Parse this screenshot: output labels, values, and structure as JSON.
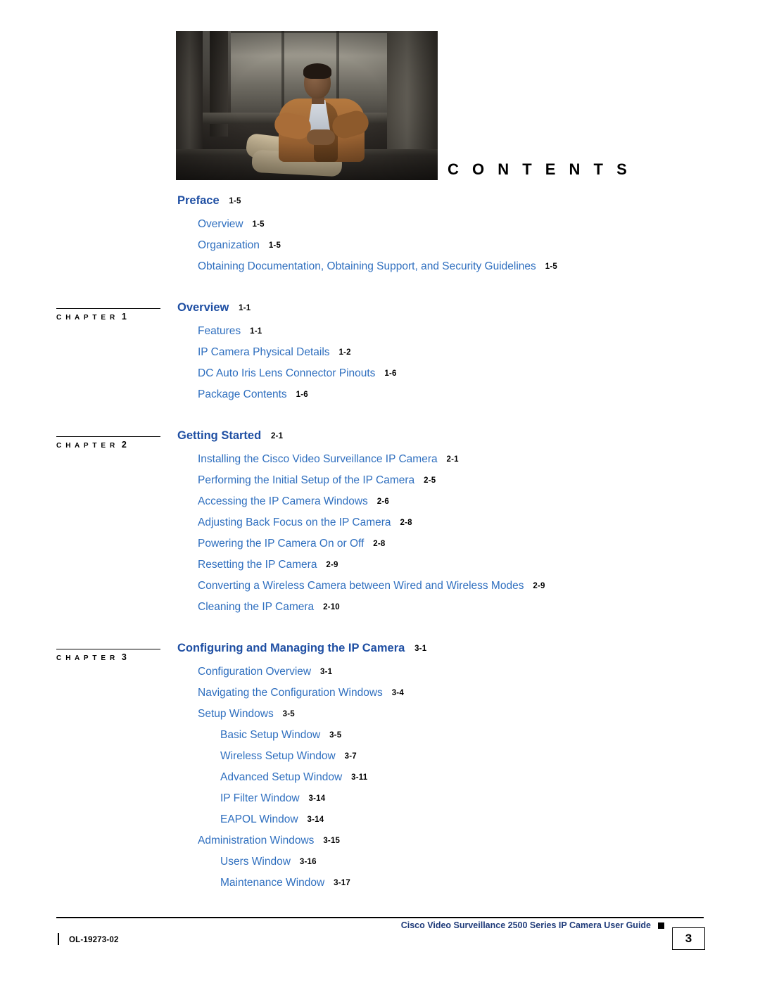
{
  "heading": "C O N T E N T S",
  "chapter_label": "C H A P T E R",
  "toc": [
    {
      "level": "h",
      "text": "Preface",
      "page": "1-5",
      "gap": "none"
    },
    {
      "level": "1",
      "text": "Overview",
      "page": "1-5",
      "gap": "afterh"
    },
    {
      "level": "1",
      "text": "Organization",
      "page": "1-5",
      "gap": "normal"
    },
    {
      "level": "1",
      "text": "Obtaining Documentation, Obtaining Support, and Security Guidelines",
      "page": "1-5",
      "gap": "normal"
    },
    {
      "level": "h",
      "text": "Overview",
      "page": "1-1",
      "gap": "big",
      "chapter": "1"
    },
    {
      "level": "1",
      "text": "Features",
      "page": "1-1",
      "gap": "afterh"
    },
    {
      "level": "1",
      "text": "IP Camera Physical Details",
      "page": "1-2",
      "gap": "normal"
    },
    {
      "level": "1",
      "text": "DC Auto Iris Lens Connector Pinouts",
      "page": "1-6",
      "gap": "normal"
    },
    {
      "level": "1",
      "text": "Package Contents",
      "page": "1-6",
      "gap": "normal"
    },
    {
      "level": "h",
      "text": "Getting Started",
      "page": "2-1",
      "gap": "big",
      "chapter": "2"
    },
    {
      "level": "1",
      "text": "Installing the Cisco Video Surveillance IP Camera",
      "page": "2-1",
      "gap": "afterh"
    },
    {
      "level": "1",
      "text": "Performing the Initial Setup of the IP Camera",
      "page": "2-5",
      "gap": "normal"
    },
    {
      "level": "1",
      "text": "Accessing the IP Camera Windows",
      "page": "2-6",
      "gap": "normal"
    },
    {
      "level": "1",
      "text": "Adjusting Back Focus on the IP Camera",
      "page": "2-8",
      "gap": "normal"
    },
    {
      "level": "1",
      "text": "Powering the IP Camera On or Off",
      "page": "2-8",
      "gap": "normal"
    },
    {
      "level": "1",
      "text": "Resetting the IP Camera",
      "page": "2-9",
      "gap": "normal"
    },
    {
      "level": "1",
      "text": "Converting a Wireless Camera between Wired and Wireless Modes",
      "page": "2-9",
      "gap": "normal"
    },
    {
      "level": "1",
      "text": "Cleaning the IP Camera",
      "page": "2-10",
      "gap": "normal"
    },
    {
      "level": "h",
      "text": "Configuring and Managing the IP Camera",
      "page": "3-1",
      "gap": "big",
      "chapter": "3"
    },
    {
      "level": "1",
      "text": "Configuration Overview",
      "page": "3-1",
      "gap": "afterh"
    },
    {
      "level": "1",
      "text": "Navigating the Configuration Windows",
      "page": "3-4",
      "gap": "normal"
    },
    {
      "level": "1",
      "text": "Setup Windows",
      "page": "3-5",
      "gap": "normal"
    },
    {
      "level": "2",
      "text": "Basic Setup Window",
      "page": "3-5",
      "gap": "normal"
    },
    {
      "level": "2",
      "text": "Wireless Setup Window",
      "page": "3-7",
      "gap": "normal"
    },
    {
      "level": "2",
      "text": "Advanced Setup Window",
      "page": "3-11",
      "gap": "normal"
    },
    {
      "level": "2",
      "text": "IP Filter Window",
      "page": "3-14",
      "gap": "normal"
    },
    {
      "level": "2",
      "text": "EAPOL Window",
      "page": "3-14",
      "gap": "normal"
    },
    {
      "level": "1",
      "text": "Administration Windows",
      "page": "3-15",
      "gap": "normal"
    },
    {
      "level": "2",
      "text": "Users Window",
      "page": "3-16",
      "gap": "normal"
    },
    {
      "level": "2",
      "text": "Maintenance Window",
      "page": "3-17",
      "gap": "normal"
    }
  ],
  "footer": {
    "guide_title": "Cisco Video Surveillance 2500 Series IP Camera User Guide",
    "doc_id": "OL-19273-02",
    "page_number": "3"
  }
}
